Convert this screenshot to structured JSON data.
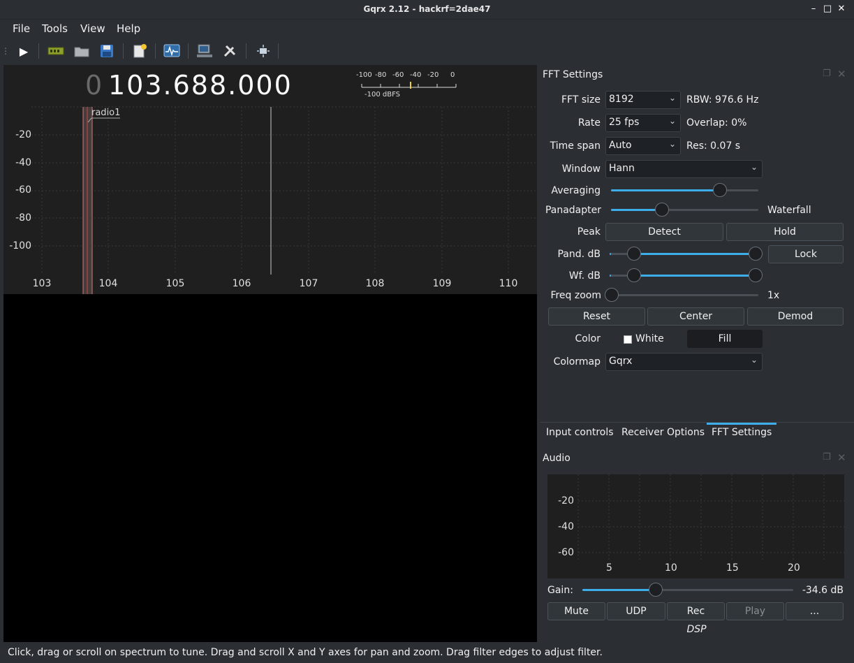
{
  "window": {
    "title": "Gqrx 2.12 - hackrf=2dae47"
  },
  "menu": [
    "File",
    "Tools",
    "View",
    "Help"
  ],
  "toolbar": [
    "play-icon",
    "hardware-icon",
    "open-icon",
    "save-icon",
    "bookmark-icon",
    "spectrum-icon",
    "network-icon",
    "tools-icon",
    "center-icon"
  ],
  "plotter": {
    "freq_prefix": "0",
    "freq": "103.688.000",
    "meter_ticks": [
      "-100",
      "-80",
      "-60",
      "-40",
      "-20",
      "0"
    ],
    "meter_label": "-100 dBFS",
    "y_labels": [
      "-20",
      "-40",
      "-60",
      "-80",
      "-100"
    ],
    "x_labels": [
      "103",
      "104",
      "105",
      "106",
      "107",
      "108",
      "109",
      "110"
    ],
    "bookmark": "radio1"
  },
  "fft": {
    "title": "FFT Settings",
    "fft_size_label": "FFT size",
    "fft_size": "8192",
    "rbw": "RBW: 976.6 Hz",
    "rate_label": "Rate",
    "rate": "25 fps",
    "overlap": "Overlap: 0%",
    "timespan_label": "Time span",
    "timespan": "Auto",
    "res": "Res: 0.07 s",
    "window_label": "Window",
    "window": "Hann",
    "averaging_label": "Averaging",
    "averaging": 0.75,
    "panadapter_label": "Panadapter",
    "panadapter": 0.35,
    "waterfall_label": "Waterfall",
    "peak_label": "Peak",
    "detect": "Detect",
    "hold": "Hold",
    "pand_label": "Pand. dB",
    "lock": "Lock",
    "wf_label": "Wf. dB",
    "zoom_label": "Freq zoom",
    "zoom_value": "1x",
    "zoom": 0,
    "reset": "Reset",
    "center": "Center",
    "demod": "Demod",
    "color_label": "Color",
    "white": "White",
    "fill": "Fill",
    "colormap_label": "Colormap",
    "colormap": "Gqrx"
  },
  "tabs": [
    "Input controls",
    "Receiver Options",
    "FFT Settings"
  ],
  "audio": {
    "title": "Audio",
    "y_labels": [
      "-20",
      "-40",
      "-60"
    ],
    "x_labels": [
      "5",
      "10",
      "15",
      "20"
    ],
    "gain_label": "Gain:",
    "gain": "-34.6 dB",
    "gain_pos": 0.35,
    "buttons": [
      "Mute",
      "UDP",
      "Rec",
      "Play",
      "..."
    ],
    "dsp": "DSP"
  },
  "status": "Click, drag or scroll on spectrum to tune. Drag and scroll X and Y axes for pan and zoom. Drag filter edges to adjust filter.",
  "colors": {
    "accent": "#3daee9",
    "filter": "#d07878"
  }
}
